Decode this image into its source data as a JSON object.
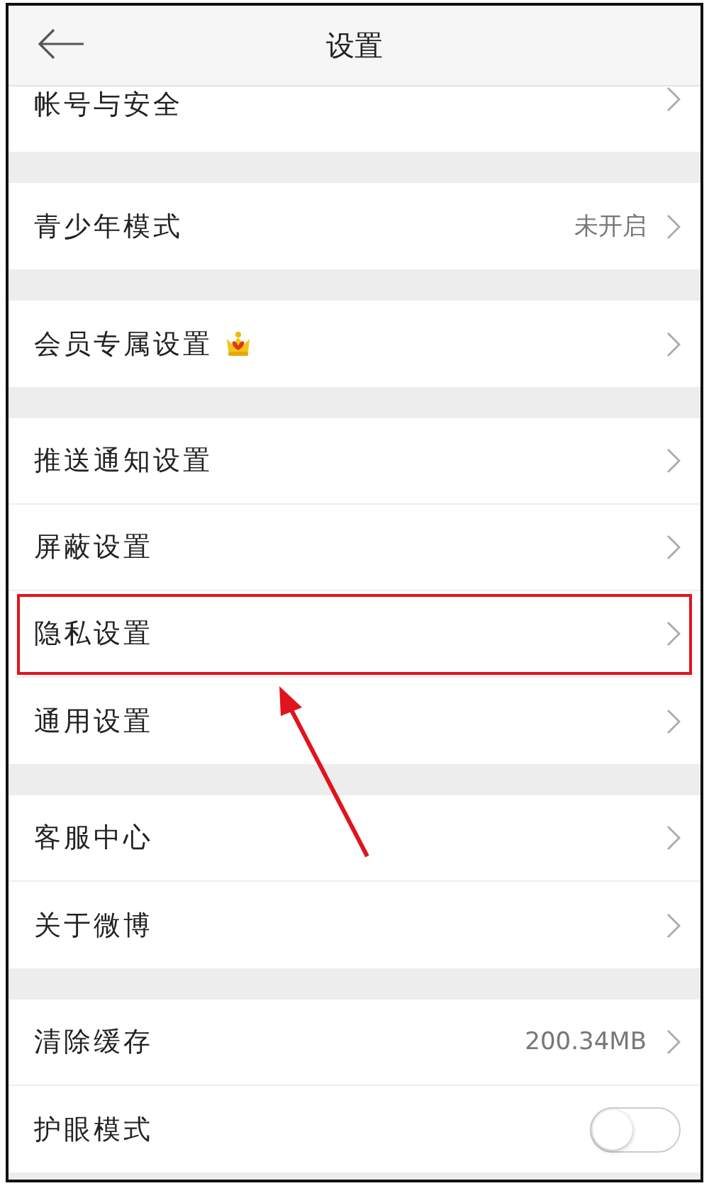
{
  "header": {
    "title": "设置"
  },
  "sections": [
    {
      "items": [
        {
          "label": "帐号与安全",
          "kind": "link",
          "partial": true
        }
      ]
    },
    {
      "items": [
        {
          "label": "青少年模式",
          "kind": "link",
          "value": "未开启"
        }
      ]
    },
    {
      "items": [
        {
          "label": "会员专属设置",
          "kind": "link",
          "crown": true
        }
      ]
    },
    {
      "items": [
        {
          "label": "推送通知设置",
          "kind": "link"
        },
        {
          "label": "屏蔽设置",
          "kind": "link"
        },
        {
          "label": "隐私设置",
          "kind": "link",
          "highlighted": true
        },
        {
          "label": "通用设置",
          "kind": "link"
        }
      ]
    },
    {
      "items": [
        {
          "label": "客服中心",
          "kind": "link"
        },
        {
          "label": "关于微博",
          "kind": "link"
        }
      ]
    },
    {
      "items": [
        {
          "label": "清除缓存",
          "kind": "link",
          "value": "200.34MB"
        },
        {
          "label": "护眼模式",
          "kind": "toggle",
          "on": false
        }
      ]
    }
  ],
  "annotation_arrow": true
}
